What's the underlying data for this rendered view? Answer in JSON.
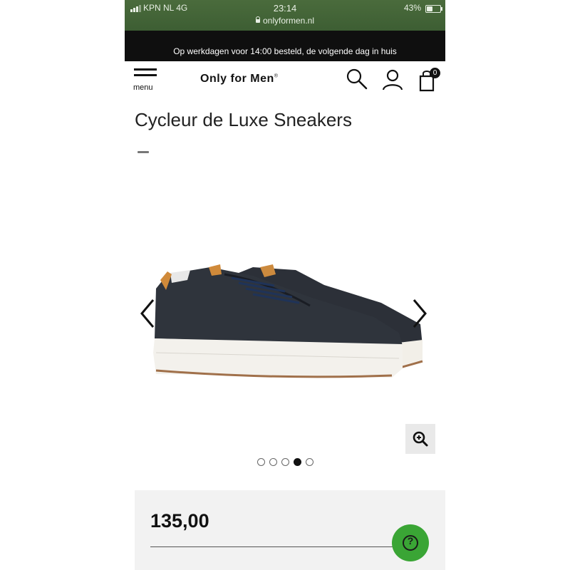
{
  "status_bar": {
    "carrier": "KPN NL  4G",
    "time": "23:14",
    "battery": "43%",
    "battery_level": 0.43,
    "url": "onlyformen.nl"
  },
  "promo_banner": "Op werkdagen voor 14:00 besteld, de volgende dag in huis",
  "header": {
    "menu_label": "menu",
    "logo": "Only for Men",
    "logo_mark": "®",
    "cart_count": "0"
  },
  "product": {
    "title": "Cycleur de Luxe Sneakers",
    "image_count": 5,
    "active_image": 3,
    "price": "135,00"
  },
  "colors": {
    "status_bar": "#3d5e33",
    "promo": "#0f0f0f",
    "help_button": "#3aa535",
    "price_box": "#f2f2f2"
  },
  "icons": [
    "hamburger-menu-icon",
    "search-icon",
    "user-icon",
    "shopping-bag-icon",
    "chevron-left-icon",
    "chevron-right-icon",
    "zoom-in-icon",
    "help-icon",
    "lock-icon"
  ]
}
